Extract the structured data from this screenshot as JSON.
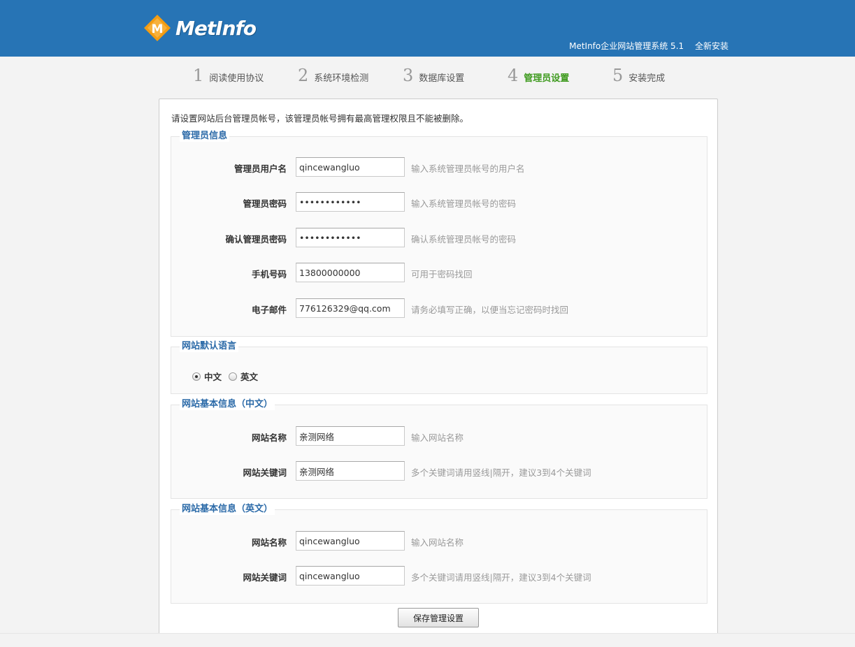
{
  "header": {
    "logo_letter": "M",
    "logo_text": "MetInfo",
    "system_name": "MetInfo企业网站管理系统 5.1",
    "mode": "全新安装",
    "colors": {
      "bar": "#2774b5",
      "logo_mark": "#f39c12"
    }
  },
  "steps": [
    {
      "num": "1",
      "label": "阅读使用协议"
    },
    {
      "num": "2",
      "label": "系统环境检测"
    },
    {
      "num": "3",
      "label": "数据库设置"
    },
    {
      "num": "4",
      "label": "管理员设置"
    },
    {
      "num": "5",
      "label": "安装完成"
    }
  ],
  "intro": "请设置网站后台管理员帐号，该管理员帐号拥有最高管理权限且不能被删除。",
  "admin": {
    "legend": "管理员信息",
    "rows": [
      {
        "label": "管理员用户名",
        "value": "qincewangluo",
        "hint": "输入系统管理员帐号的用户名"
      },
      {
        "label": "管理员密码",
        "value": "••••••••••••",
        "hint": "输入系统管理员帐号的密码"
      },
      {
        "label": "确认管理员密码",
        "value": "••••••••••••",
        "hint": "确认系统管理员帐号的密码"
      },
      {
        "label": "手机号码",
        "value": "13800000000",
        "hint": "可用于密码找回"
      },
      {
        "label": "电子邮件",
        "value": "776126329@qq.com",
        "hint": "请务必填写正确，以便当忘记密码时找回"
      }
    ]
  },
  "language": {
    "legend": "网站默认语言",
    "options": [
      "中文",
      "英文"
    ],
    "selected": "中文"
  },
  "site_cn": {
    "legend": "网站基本信息（中文）",
    "rows": [
      {
        "label": "网站名称",
        "value": "亲测网络",
        "hint": "输入网站名称"
      },
      {
        "label": "网站关键词",
        "value": "亲测网络",
        "hint": "多个关键词请用竖线|隔开，建议3到4个关键词"
      }
    ]
  },
  "site_en": {
    "legend": "网站基本信息（英文）",
    "rows": [
      {
        "label": "网站名称",
        "value": "qincewangluo",
        "hint": "输入网站名称"
      },
      {
        "label": "网站关键词",
        "value": "qincewangluo",
        "hint": "多个关键词请用竖线|隔开，建议3到4个关键词"
      }
    ]
  },
  "save_label": "保存管理设置"
}
